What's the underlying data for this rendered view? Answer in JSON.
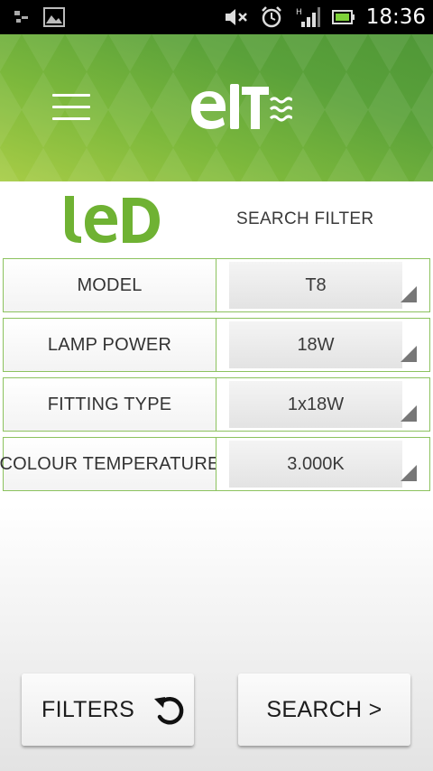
{
  "status_bar": {
    "time": "18:36",
    "icons": [
      "usb-debug-icon",
      "image-icon",
      "mute-icon",
      "alarm-icon",
      "signal-icon",
      "battery-icon"
    ]
  },
  "header": {
    "menu_icon": "hamburger-menu-icon",
    "logo_text": "elt",
    "colors": {
      "brand_green": "#7cb83c"
    }
  },
  "subheader": {
    "led_logo_text": "LED",
    "title": "SEARCH FILTER"
  },
  "filters": [
    {
      "label": "MODEL",
      "value": "T8"
    },
    {
      "label": "LAMP POWER",
      "value": "18W"
    },
    {
      "label": "FITTING TYPE",
      "value": "1x18W"
    },
    {
      "label": "COLOUR TEMPERATURE",
      "value": "3.000K"
    }
  ],
  "buttons": {
    "filters_label": "FILTERS",
    "filters_icon": "reset-icon",
    "search_label": "SEARCH >"
  }
}
